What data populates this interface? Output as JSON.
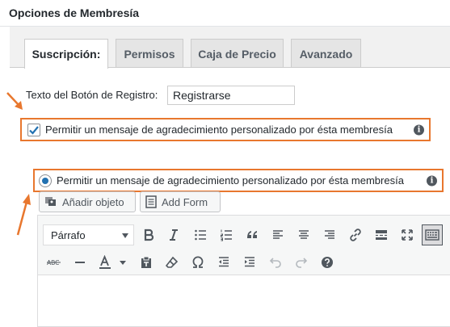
{
  "panel": {
    "title": "Opciones de Membresía"
  },
  "tabs": [
    {
      "label": "Suscripción:",
      "active": true
    },
    {
      "label": "Permisos",
      "active": false
    },
    {
      "label": "Caja de Precio",
      "active": false
    },
    {
      "label": "Avanzado",
      "active": false
    }
  ],
  "signup_button": {
    "label": "Texto del Botón de Registro:",
    "value": "Registrarse"
  },
  "checkbox_option": {
    "label": "Permitir un mensaje de agradecimiento personalizado por ésta membresía",
    "checked": true
  },
  "radio_option": {
    "label": "Permitir un mensaje de agradecimiento personalizado por ésta membresía",
    "selected": true
  },
  "media_buttons": {
    "add_object": "Añadir objeto",
    "add_form": "Add Form"
  },
  "editor": {
    "format_value": "Párrafo"
  },
  "colors": {
    "highlight": "#e8772e",
    "accent": "#2271b1"
  },
  "icons": [
    "bold-icon",
    "italic-icon",
    "bullet-list-icon",
    "numbered-list-icon",
    "blockquote-icon",
    "align-left-icon",
    "align-center-icon",
    "align-right-icon",
    "link-icon",
    "read-more-icon",
    "fullscreen-icon",
    "toolbar-toggle-icon",
    "strikethrough-icon",
    "horizontal-line-icon",
    "text-color-icon",
    "paste-text-icon",
    "clear-formatting-icon",
    "special-character-icon",
    "outdent-icon",
    "indent-icon",
    "undo-icon",
    "redo-icon",
    "help-icon"
  ]
}
